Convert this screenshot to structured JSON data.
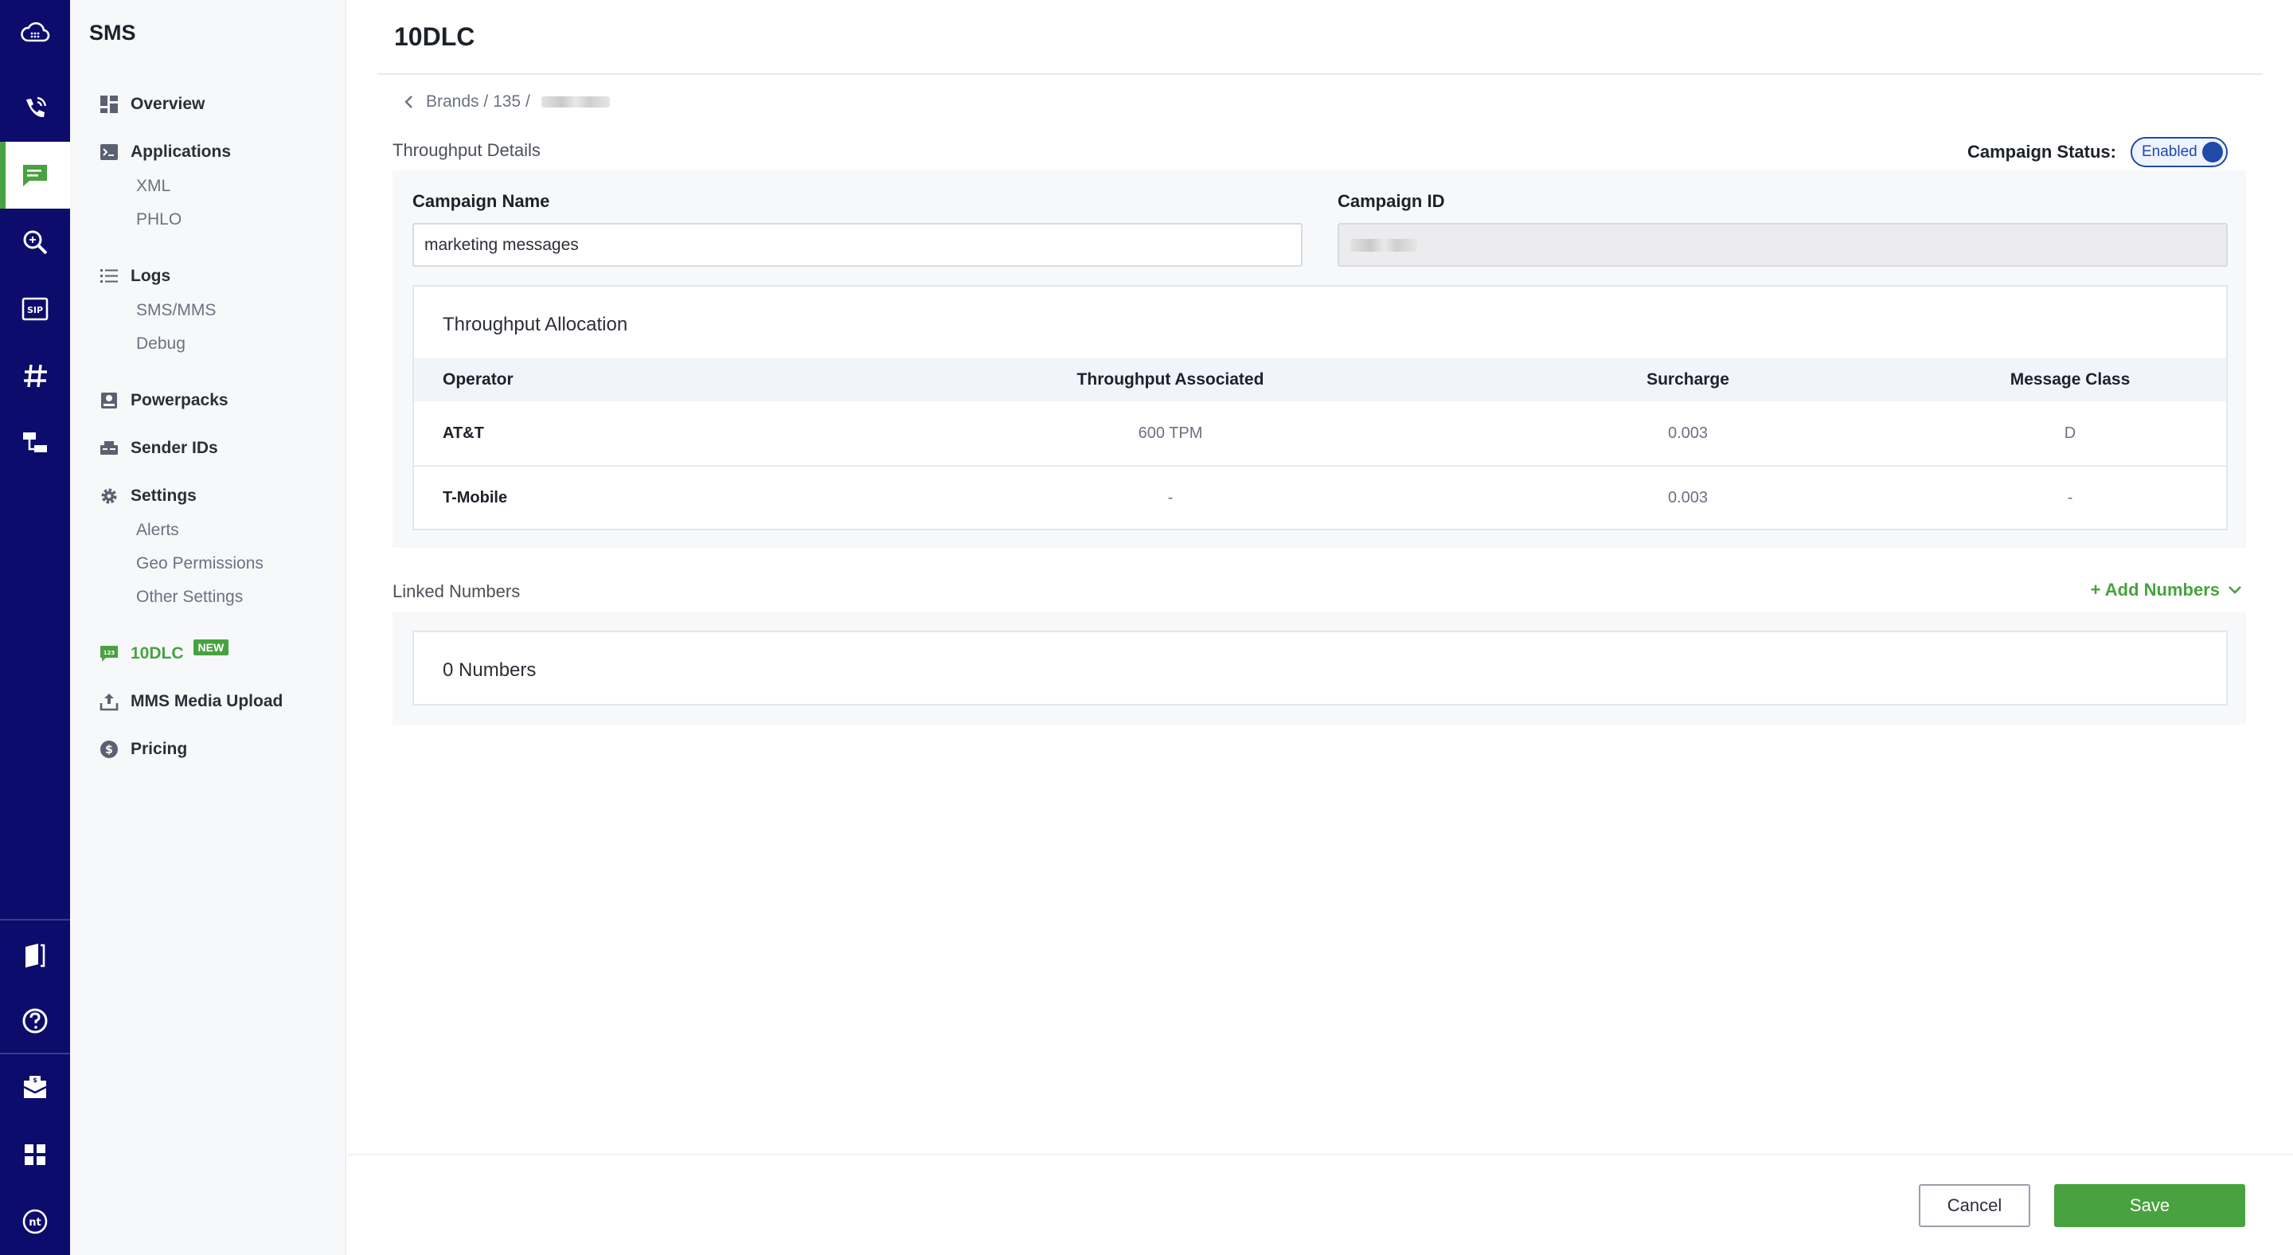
{
  "sidebar": {
    "title": "SMS",
    "items": {
      "overview": "Overview",
      "applications": "Applications",
      "xml": "XML",
      "phlo": "PHLO",
      "logs": "Logs",
      "sms_mms": "SMS/MMS",
      "debug": "Debug",
      "powerpacks": "Powerpacks",
      "sender_ids": "Sender IDs",
      "settings": "Settings",
      "alerts": "Alerts",
      "geo_permissions": "Geo Permissions",
      "other_settings": "Other Settings",
      "tendlc": "10DLC",
      "tendlc_badge": "NEW",
      "mms_media_upload": "MMS Media Upload",
      "pricing": "Pricing"
    }
  },
  "header": {
    "title": "10DLC"
  },
  "breadcrumb": {
    "brands": "Brands",
    "sep1": " / ",
    "brand_id": "135",
    "sep2": " / "
  },
  "throughput": {
    "section_label": "Throughput Details",
    "status_label": "Campaign Status:",
    "status_toggle": "Enabled",
    "campaign_name_label": "Campaign Name",
    "campaign_name_value": "marketing messages",
    "campaign_id_label": "Campaign ID",
    "allocation": {
      "title": "Throughput Allocation",
      "columns": [
        "Operator",
        "Throughput Associated",
        "Surcharge",
        "Message Class"
      ],
      "rows": [
        [
          "AT&T",
          "600 TPM",
          "0.003",
          "D"
        ],
        [
          "T-Mobile",
          "-",
          "0.003",
          "-"
        ]
      ]
    }
  },
  "linked_numbers": {
    "section_label": "Linked Numbers",
    "add_label": "+ Add Numbers",
    "count_text": "0 Numbers"
  },
  "footer": {
    "cancel_label": "Cancel",
    "save_label": "Save"
  },
  "colors": {
    "rail": "#0b0c6b",
    "accent_green": "#48a23f",
    "toggle_blue": "#1f4aa8"
  }
}
